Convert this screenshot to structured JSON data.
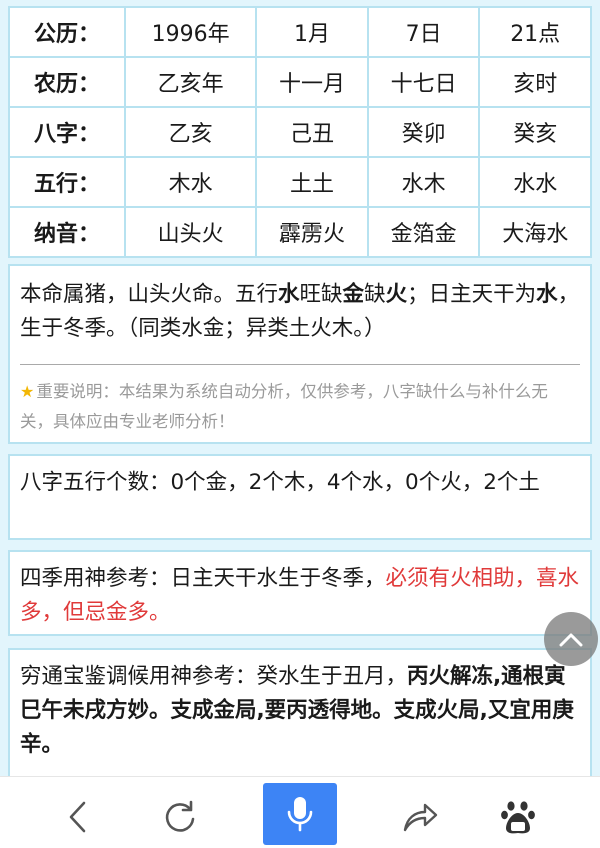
{
  "table": {
    "rows": [
      {
        "label": "公历：",
        "cells": [
          "1996年",
          "1月",
          "7日",
          "21点"
        ]
      },
      {
        "label": "农历：",
        "cells": [
          "乙亥年",
          "十一月",
          "十七日",
          "亥时"
        ]
      },
      {
        "label": "八字：",
        "cells": [
          "乙亥",
          "己丑",
          "癸卯",
          "癸亥"
        ]
      },
      {
        "label": "五行：",
        "cells": [
          "木水",
          "土土",
          "水木",
          "水水"
        ]
      },
      {
        "label": "纳音：",
        "cells": [
          "山头火",
          "霹雳火",
          "金箔金",
          "大海水"
        ]
      }
    ]
  },
  "summary": {
    "t1": "本命属猪，山头火命。五行",
    "t2": "水",
    "t3": "旺缺",
    "t4": "金",
    "t5": "缺",
    "t6": "火",
    "t7": "；日主天干",
    "t8": "为",
    "t9": "水",
    "t10": "，生于冬季。（同类水金；异类土火木。）"
  },
  "note": {
    "icon": "star-icon",
    "text": "重要说明：本结果为系统自动分析，仅供参考，八字缺什么与补什么无关，具体应由专业老师分析！"
  },
  "count": {
    "text": "八字五行个数：0个金，2个木，4个水，0个火，2个土"
  },
  "season": {
    "plain": "四季用神参考：日主天干水生于冬季，",
    "red": "必须有火相助，喜水多，但忌金多。"
  },
  "qiongtong": {
    "plain": "穷通宝鉴调候用神参考：癸水生于丑月，",
    "bold": "丙火解冻,通根寅巳午未戌方妙。支成金局,要丙透得地。支成火局,又宜用庚辛。"
  },
  "scroll_top": {
    "icon": "chevron-up-icon"
  },
  "bottom_bar": {
    "back": {
      "icon": "back-arrow-icon"
    },
    "refresh": {
      "icon": "refresh-icon"
    },
    "voice": {
      "icon": "microphone-icon",
      "color": "#3d84f5"
    },
    "share": {
      "icon": "share-icon"
    },
    "baidu": {
      "icon": "baidu-paw-icon"
    }
  },
  "colors": {
    "background": "#e2f5fc",
    "border": "#b7e2f0",
    "accent_red": "#e03a3a"
  }
}
